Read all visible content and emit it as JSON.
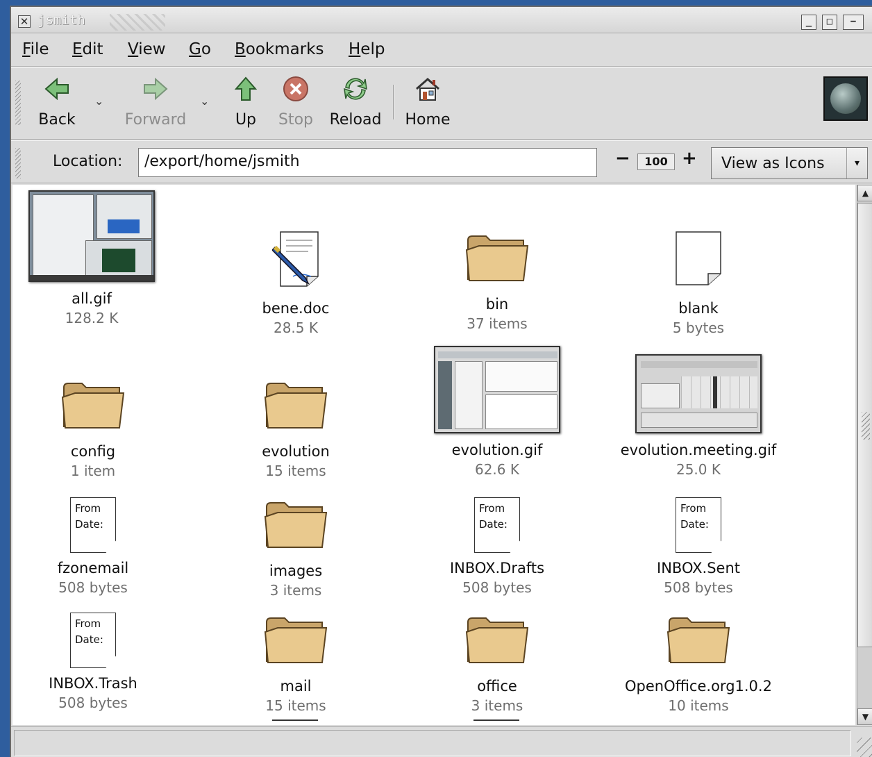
{
  "window": {
    "title": "jsmith",
    "controls": [
      "_",
      "□",
      "−"
    ]
  },
  "menubar": {
    "items": [
      {
        "label": "File",
        "mnemonic": "F",
        "rest": "ile"
      },
      {
        "label": "Edit",
        "mnemonic": "E",
        "rest": "dit"
      },
      {
        "label": "View",
        "mnemonic": "V",
        "rest": "iew"
      },
      {
        "label": "Go",
        "mnemonic": "G",
        "rest": "o"
      },
      {
        "label": "Bookmarks",
        "mnemonic": "B",
        "rest": "ookmarks"
      },
      {
        "label": "Help",
        "mnemonic": "H",
        "rest": "elp"
      }
    ]
  },
  "toolbar": {
    "back": "Back",
    "forward": "Forward",
    "up": "Up",
    "stop": "Stop",
    "reload": "Reload",
    "home": "Home"
  },
  "location": {
    "label": "Location:",
    "value": "/export/home/jsmith",
    "zoom": "100",
    "view_mode": "View as Icons"
  },
  "files": [
    {
      "name": "all.gif",
      "size": "128.2 K",
      "icon": "image-thumbnail"
    },
    {
      "name": "bene.doc",
      "size": "28.5 K",
      "icon": "document-pen-icon"
    },
    {
      "name": "bin",
      "size": "37 items",
      "icon": "folder-icon"
    },
    {
      "name": "blank",
      "size": "5 bytes",
      "icon": "blank-file-icon"
    },
    {
      "name": "config",
      "size": "1 item",
      "icon": "folder-icon"
    },
    {
      "name": "evolution",
      "size": "15 items",
      "icon": "folder-icon"
    },
    {
      "name": "evolution.gif",
      "size": "62.6 K",
      "icon": "image-thumbnail"
    },
    {
      "name": "evolution.meeting.gif",
      "size": "25.0 K",
      "icon": "image-thumbnail"
    },
    {
      "name": "fzonemail",
      "size": "508 bytes",
      "icon": "mail-file-icon"
    },
    {
      "name": "images",
      "size": "3 items",
      "icon": "folder-icon"
    },
    {
      "name": "INBOX.Drafts",
      "size": "508 bytes",
      "icon": "mail-file-icon"
    },
    {
      "name": "INBOX.Sent",
      "size": "508 bytes",
      "icon": "mail-file-icon"
    },
    {
      "name": "INBOX.Trash",
      "size": "508 bytes",
      "icon": "mail-file-icon"
    },
    {
      "name": "mail",
      "size": "15 items",
      "icon": "folder-icon"
    },
    {
      "name": "office",
      "size": "3 items",
      "icon": "folder-icon"
    },
    {
      "name": "OpenOffice.org1.0.2",
      "size": "10 items",
      "icon": "folder-icon"
    }
  ],
  "mail_preview": {
    "line1": "From",
    "line2": "Date:"
  },
  "colors": {
    "folder": "#e9c98e",
    "desktop": "#2f5e9e",
    "window_bg": "#dcdcdc"
  }
}
